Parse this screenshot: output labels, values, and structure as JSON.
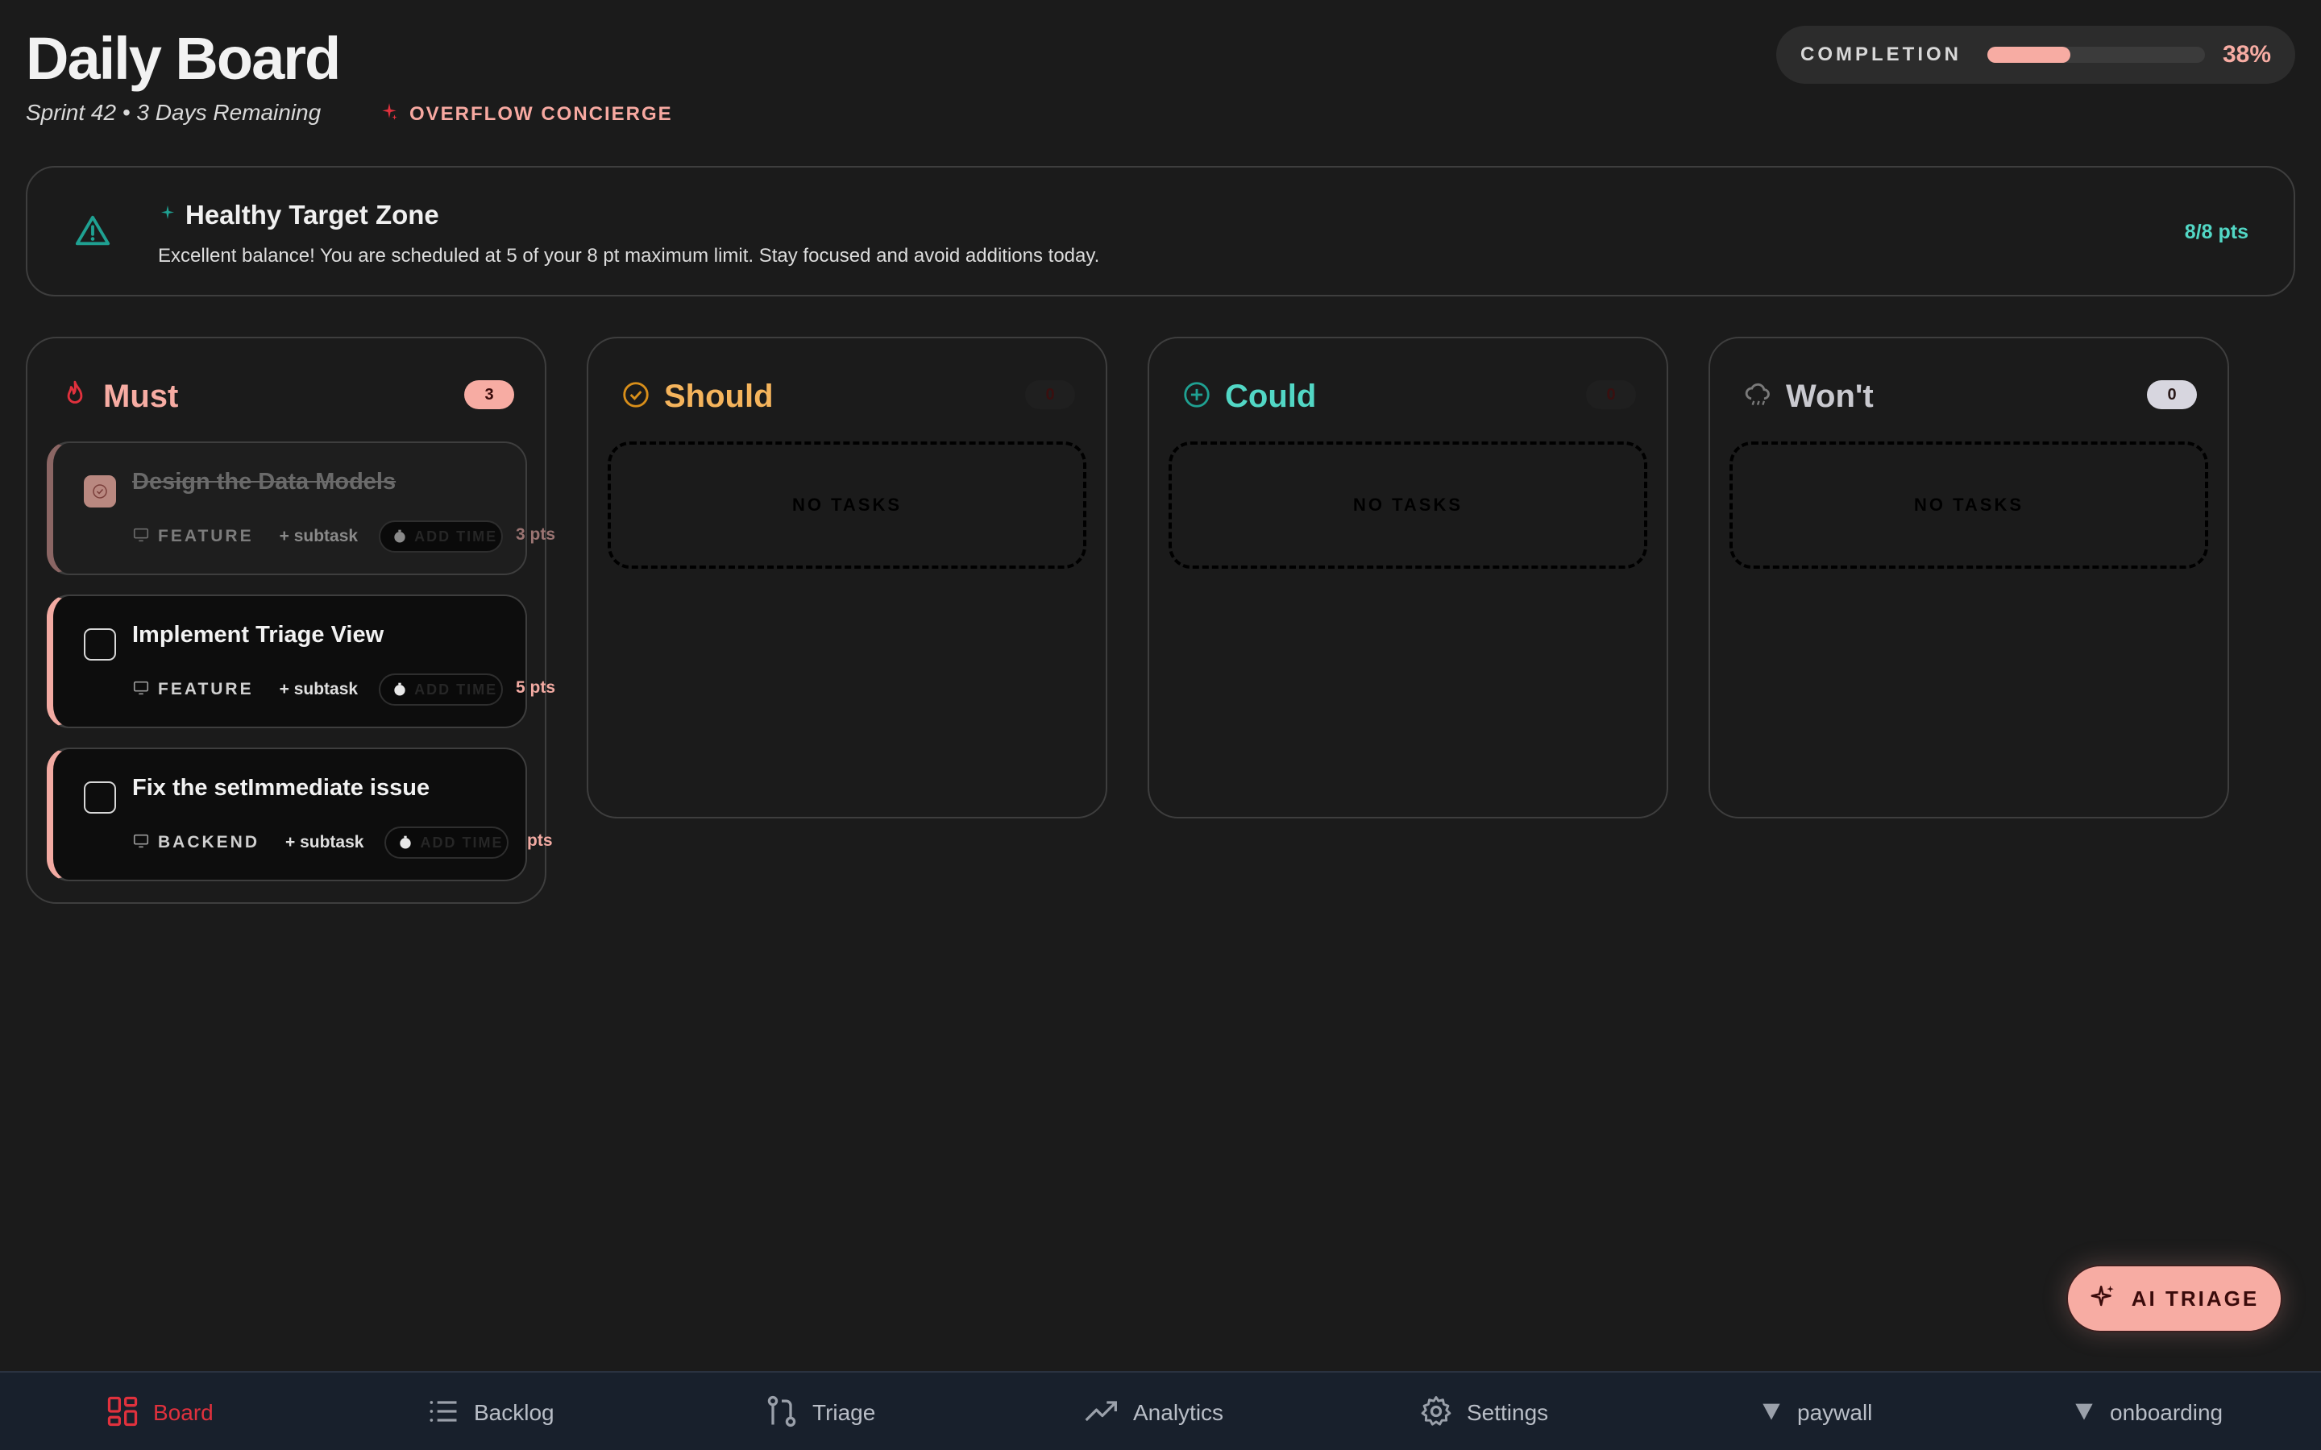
{
  "header": {
    "title": "Daily Board",
    "subtitle": "Sprint 42 • 3 Days Remaining",
    "concierge_label": "OVERFLOW CONCIERGE"
  },
  "completion": {
    "label": "COMPLETION",
    "value": "38%",
    "fraction": 0.38
  },
  "zone": {
    "title": "Healthy Target Zone",
    "description": "Excellent balance! You are scheduled at 5 of your 8 pt maximum limit. Stay focused and avoid additions today.",
    "points": "8/8 pts"
  },
  "columns": {
    "must": {
      "title": "Must",
      "count": "3",
      "tasks": [
        {
          "title": "Design the Data Models",
          "tag": "FEATURE",
          "subtask": "+ subtask",
          "time": "ADD TIME",
          "points": "3 pts",
          "done": true
        },
        {
          "title": "Implement Triage View",
          "tag": "FEATURE",
          "subtask": "+ subtask",
          "time": "ADD TIME",
          "points": "5 pts",
          "done": false
        },
        {
          "title": "Fix the setImmediate issue",
          "tag": "BACKEND",
          "subtask": "+ subtask",
          "time": "ADD TIME",
          "points": "pts",
          "done": false
        }
      ]
    },
    "should": {
      "title": "Should",
      "count": "0",
      "empty": "NO TASKS"
    },
    "could": {
      "title": "Could",
      "count": "0",
      "empty": "NO TASKS"
    },
    "wont": {
      "title": "Won't",
      "count": "0",
      "empty": "NO TASKS"
    }
  },
  "ai_triage": {
    "label": "AI TRIAGE"
  },
  "nav": {
    "items": [
      {
        "label": "Board",
        "icon": "grid-icon",
        "active": true
      },
      {
        "label": "Backlog",
        "icon": "list-icon"
      },
      {
        "label": "Triage",
        "icon": "git-branch-icon"
      },
      {
        "label": "Analytics",
        "icon": "trend-icon"
      },
      {
        "label": "Settings",
        "icon": "gear-icon"
      },
      {
        "label": "paywall",
        "icon": "triangle-down-icon"
      },
      {
        "label": "onboarding",
        "icon": "triangle-down-icon"
      }
    ]
  },
  "colors": {
    "accent": "#f7aca3",
    "must": "#f7aca3",
    "should": "#f5b45c",
    "could": "#52d7c5",
    "wont": "#c9c9cf",
    "nav_active": "#e0313d"
  }
}
